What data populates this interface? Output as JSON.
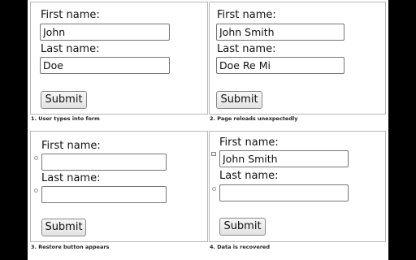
{
  "panels": [
    {
      "first_label": "First name:",
      "first_value": "John",
      "last_label": "Last name:",
      "last_value": "Doe",
      "submit": "Submit",
      "caption": "1. User types into form"
    },
    {
      "first_label": "First name:",
      "first_value": "John Smith",
      "last_label": "Last name:",
      "last_value": "Doe Re Mi",
      "submit": "Submit",
      "caption": "2. Page reloads unexpectedly"
    },
    {
      "first_label": "First name:",
      "first_value": "",
      "last_label": "Last name:",
      "last_value": "",
      "submit": "Submit",
      "caption": "3. Restore button appears"
    },
    {
      "first_label": "First name:",
      "first_value": "John Smith",
      "last_label": "Last name:",
      "last_value": "",
      "submit": "Submit",
      "caption": "4. Data is recovered"
    }
  ],
  "colors": {
    "background": "#000000",
    "panel_border": "#b8b8b8"
  }
}
